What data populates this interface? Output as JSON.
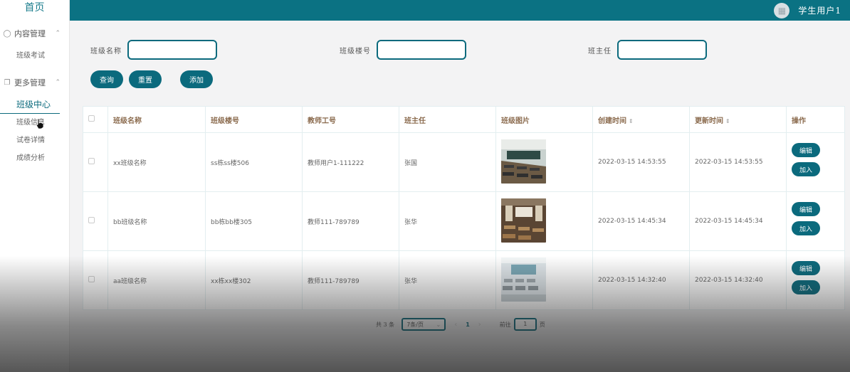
{
  "sidebar": {
    "home": "首页",
    "groups": [
      {
        "label": "内容管理",
        "items": [
          "班级考试"
        ]
      },
      {
        "label": "更多管理",
        "items": [
          "班级中心",
          "班级信息",
          "试卷详情",
          "成绩分析"
        ]
      }
    ]
  },
  "header": {
    "username": "学生用户1"
  },
  "search": {
    "class_name_label": "班级名称",
    "building_label": "班级楼号",
    "teacher_label": "班主任",
    "query": "查询",
    "reset": "重置",
    "add": "添加"
  },
  "table": {
    "headers": [
      "班级名称",
      "班级楼号",
      "教师工号",
      "班主任",
      "班级图片",
      "创建时间",
      "更新时间",
      "操作"
    ],
    "rows": [
      {
        "name": "xx班级名称",
        "building": "ss栋ss楼506",
        "teacher_id": "教师用户1-111222",
        "head": "张国",
        "created": "2022-03-15 14:53:55",
        "updated": "2022-03-15 14:53:55"
      },
      {
        "name": "bb班级名称",
        "building": "bb栋bb楼305",
        "teacher_id": "教师111-789789",
        "head": "张华",
        "created": "2022-03-15 14:45:34",
        "updated": "2022-03-15 14:45:34"
      },
      {
        "name": "aa班级名称",
        "building": "xx栋xx楼302",
        "teacher_id": "教师111-789789",
        "head": "张华",
        "created": "2022-03-15 14:32:40",
        "updated": "2022-03-15 14:32:40"
      }
    ],
    "edit": "编辑",
    "join": "加入"
  },
  "pager": {
    "total": "共 3 条",
    "page_size": "7条/页",
    "current": "1",
    "goto_label": "前往",
    "goto_value": "1",
    "page_suffix": "页"
  },
  "colors": {
    "accent": "#0b6a7d",
    "topbar": "#0b7283"
  }
}
